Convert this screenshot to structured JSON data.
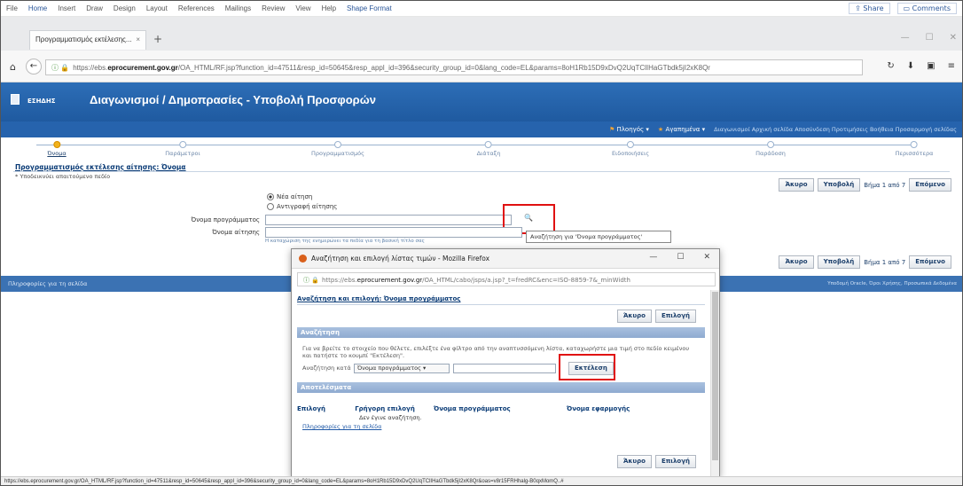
{
  "ribbon": {
    "tabs": [
      "File",
      "Home",
      "Insert",
      "Draw",
      "Design",
      "Layout",
      "References",
      "Mailings",
      "Review",
      "View",
      "Help",
      "Shape Format"
    ],
    "share": "Share",
    "comments": "Comments"
  },
  "browser": {
    "tab_title": "Προγραμματισμός εκτέλεσης...",
    "tab_close": "×",
    "new_tab": "+",
    "url_prefix": "https://ebs.",
    "url_host": "eprocurement.gov.gr",
    "url_path": "/OA_HTML/RF.jsp?function_id=47511&resp_id=50645&resp_appl_id=396&security_group_id=0&lang_code=EL&params=8oH1Rb15D9xDvQ2UqTClIHaGTbdk5jI2xK8Qr",
    "status_url": "https://ebs.eprocurement.gov.gr/OA_HTML/RF.jsp?function_id=47511&resp_id=50645&resp_appl_id=396&security_group_id=0&lang_code=EL&params=8oH1Rb15D9xDvQ2UqTClIHaGTbdk5jI2xK8Qr&oas=v8r15FRHhalg-B0qxMomQ..#"
  },
  "app": {
    "brand": "ΕΣΗΔΗΣ",
    "title": "Διαγωνισμοί / Δημοπρασίες - Υποβολή Προσφορών",
    "menu_1": "Πλοηγός",
    "menu_2": "Αγαπημένα",
    "global_links": "Διαγωνισμοί  Αρχική σελίδα  Αποσύνδεση  Προτιμήσεις  Βοήθεια  Προσαρμογή σελίδας"
  },
  "train": [
    "Όνομα",
    "Παράμετροι",
    "Προγραμματισμός",
    "Διάταξη",
    "Ειδοποιήσεις",
    "Παράδοση",
    "Περισσότερα"
  ],
  "page": {
    "title": "Προγραμματισμός εκτέλεσης αίτησης: Όνομα",
    "required_note": "* Υποδεικνύει απαιτούμενο πεδίο",
    "cancel": "Άκυρο",
    "submit": "Υποβολή",
    "step_text": "Βήμα 1 από 7",
    "next": "Επόμενο",
    "radio_new": "Νέα αίτηση",
    "radio_copy": "Αντιγραφή αίτησης",
    "label_program": "Όνομα προγράμματος",
    "label_request": "Όνομα αίτησης",
    "hint": "Η καταχώριση της ενημερώνει τα πεδία για τη βασική τίτλο σας",
    "tooltip": "Αναζήτηση για 'Όνομα προγράμματος'",
    "footer_left": "Πληροφορίες για τη σελίδα",
    "footer_right": "Υποδομή Oracle, Όροι Χρήσης, Προσωπικά Δεδομένα"
  },
  "popup": {
    "title": "Αναζήτηση και επιλογή λίστας τιμών - Mozilla Firefox",
    "url_prefix": "https://ebs.",
    "url_host": "eprocurement.gov.gr",
    "url_path": "/OA_HTML/cabo/jsps/a.jsp?_t=fredRC&enc=ISO-8859-7&_minWidth",
    "heading": "Αναζήτηση και επιλογή: Όνομα προγράμματος",
    "cancel": "Άκυρο",
    "select": "Επιλογή",
    "search_section": "Αναζήτηση",
    "instructions": "Για να βρείτε το στοιχείο που θέλετε, επιλέξτε ένα φίλτρο από την αναπτυσσόμενη λίστα, καταχωρήστε μια τιμή στο πεδίο κειμένου και πατήστε το κουμπί \"Εκτέλεση\".",
    "search_by": "Αναζήτηση κατά",
    "search_option": "Όνομα προγράμματος",
    "go": "Εκτέλεση",
    "results_section": "Αποτελέσματα",
    "columns": [
      "Επιλογή",
      "Γρήγορη επιλογή",
      "Όνομα προγράμματος",
      "Όνομα εφαρμογής"
    ],
    "no_search": "Δεν έγινε αναζήτηση.",
    "page_info": "Πληροφορίες για τη σελίδα"
  }
}
